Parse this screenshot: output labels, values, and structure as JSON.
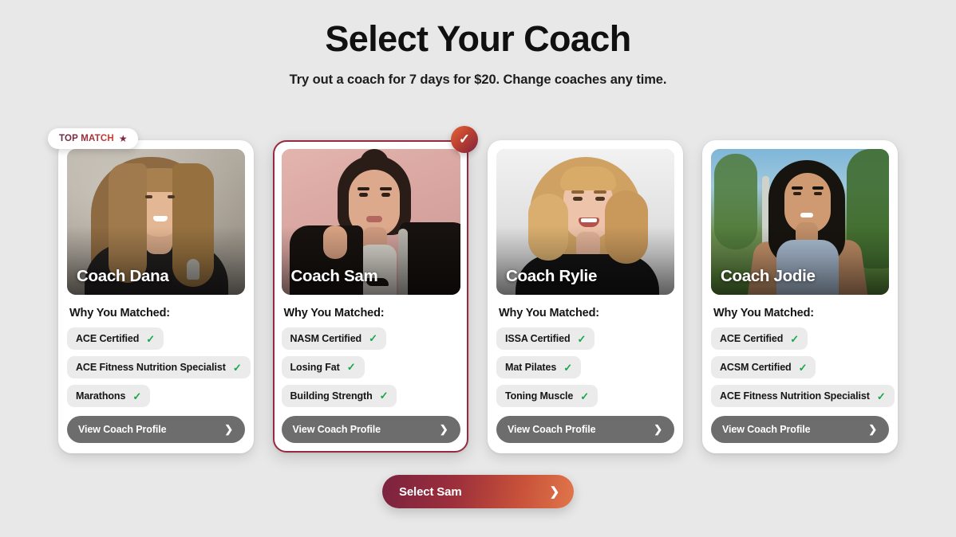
{
  "header": {
    "title": "Select Your Coach",
    "subtitle": "Try out a coach for 7 days for $20. Change coaches any time."
  },
  "badges": {
    "top_match_label": "TOP MATCH",
    "top_match_icon": "star-icon",
    "selected_icon": "check-icon"
  },
  "labels": {
    "matched_heading": "Why You Matched:",
    "profile_button": "View Coach Profile",
    "chevron_icon": "chevron-right-icon",
    "chip_check_icon": "check-icon"
  },
  "cta": {
    "label": "Select Sam",
    "chevron_icon": "chevron-right-icon"
  },
  "colors": {
    "page_background": "#e8e8e8",
    "card_background": "#ffffff",
    "selected_border": "#962b3f",
    "chip_background": "#ebebeb",
    "chip_check": "#17a64a",
    "profile_button": "#6d6d6d",
    "cta_gradient_start": "#7b2240",
    "cta_gradient_end": "#e0764a",
    "top_match_text_start": "#5e2749",
    "top_match_text_end": "#d33b2c"
  },
  "coaches": [
    {
      "name": "Coach Dana",
      "top_match": true,
      "selected": false,
      "matched_heading": "Why You Matched:",
      "chips": [
        "ACE Certified",
        "ACE Fitness Nutrition Specialist",
        "Marathons"
      ],
      "profile_button": "View Coach Profile"
    },
    {
      "name": "Coach Sam",
      "top_match": false,
      "selected": true,
      "matched_heading": "Why You Matched:",
      "chips": [
        "NASM Certified",
        "Losing Fat",
        "Building Strength"
      ],
      "profile_button": "View Coach Profile"
    },
    {
      "name": "Coach Rylie",
      "top_match": false,
      "selected": false,
      "matched_heading": "Why You Matched:",
      "chips": [
        "ISSA Certified",
        "Mat Pilates",
        "Toning Muscle"
      ],
      "profile_button": "View Coach Profile"
    },
    {
      "name": "Coach Jodie",
      "top_match": false,
      "selected": false,
      "matched_heading": "Why You Matched:",
      "chips": [
        "ACE Certified",
        "ACSM Certified",
        "ACE Fitness Nutrition Specialist"
      ],
      "profile_button": "View Coach Profile"
    }
  ]
}
